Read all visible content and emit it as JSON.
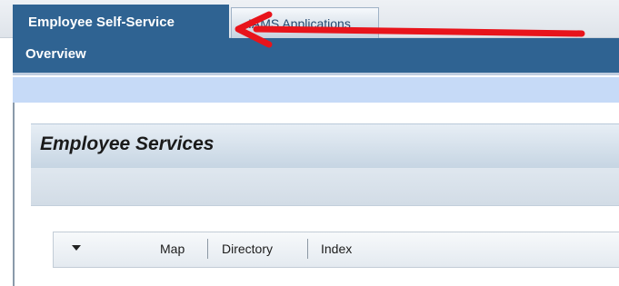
{
  "tabs": [
    {
      "label": "Employee Self-Service",
      "active": true
    },
    {
      "label": "IAMS Applications",
      "active": false
    }
  ],
  "nav": {
    "overview_label": "Overview"
  },
  "page": {
    "title": "Employee Services"
  },
  "toolbar": {
    "dropdown_icon": "triangle-down",
    "links": [
      "Map",
      "Directory",
      "Index"
    ]
  },
  "annotation": {
    "arrow_color": "#e8141b",
    "points_to": "Employee Self-Service tab"
  },
  "colors": {
    "nav_blue": "#2f6392",
    "light_band": "#c6daf7"
  }
}
